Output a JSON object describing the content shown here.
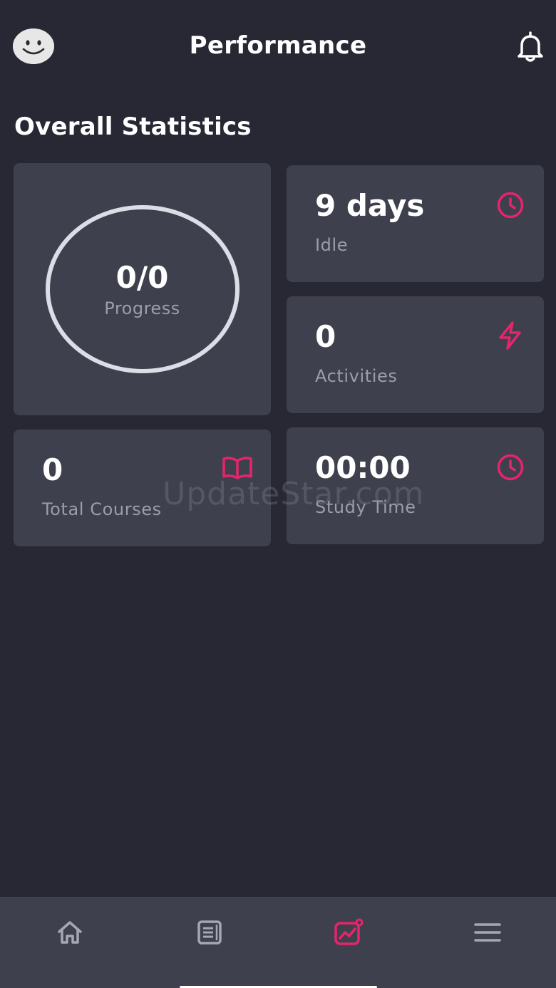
{
  "header": {
    "title": "Performance",
    "avatar_icon": "smiley-avatar-icon",
    "notification_icon": "bell-icon"
  },
  "overall": {
    "section_title": "Overall Statistics",
    "progress": {
      "value": "0/0",
      "label": "Progress"
    },
    "idle": {
      "value": "9 days",
      "label": "Idle",
      "icon": "clock-icon"
    },
    "activities": {
      "value": "0",
      "label": "Activities",
      "icon": "lightning-icon"
    },
    "total_courses": {
      "value": "0",
      "label": "Total Courses",
      "icon": "open-book-icon"
    },
    "study_time": {
      "value": "00:00",
      "label": "Study Time",
      "icon": "clock-icon"
    }
  },
  "watermark": "UpdateStar.com",
  "bottom_nav": {
    "items": [
      {
        "name": "home",
        "icon": "home-icon",
        "active": false
      },
      {
        "name": "courses",
        "icon": "document-list-icon",
        "active": false
      },
      {
        "name": "performance",
        "icon": "chart-icon",
        "active": true
      },
      {
        "name": "menu",
        "icon": "hamburger-menu-icon",
        "active": false
      }
    ]
  },
  "colors": {
    "background": "#272833",
    "card": "#3f404d",
    "accent": "#e5256b",
    "muted_text": "#9c9dab",
    "nav_icon": "#a6a7b3"
  }
}
